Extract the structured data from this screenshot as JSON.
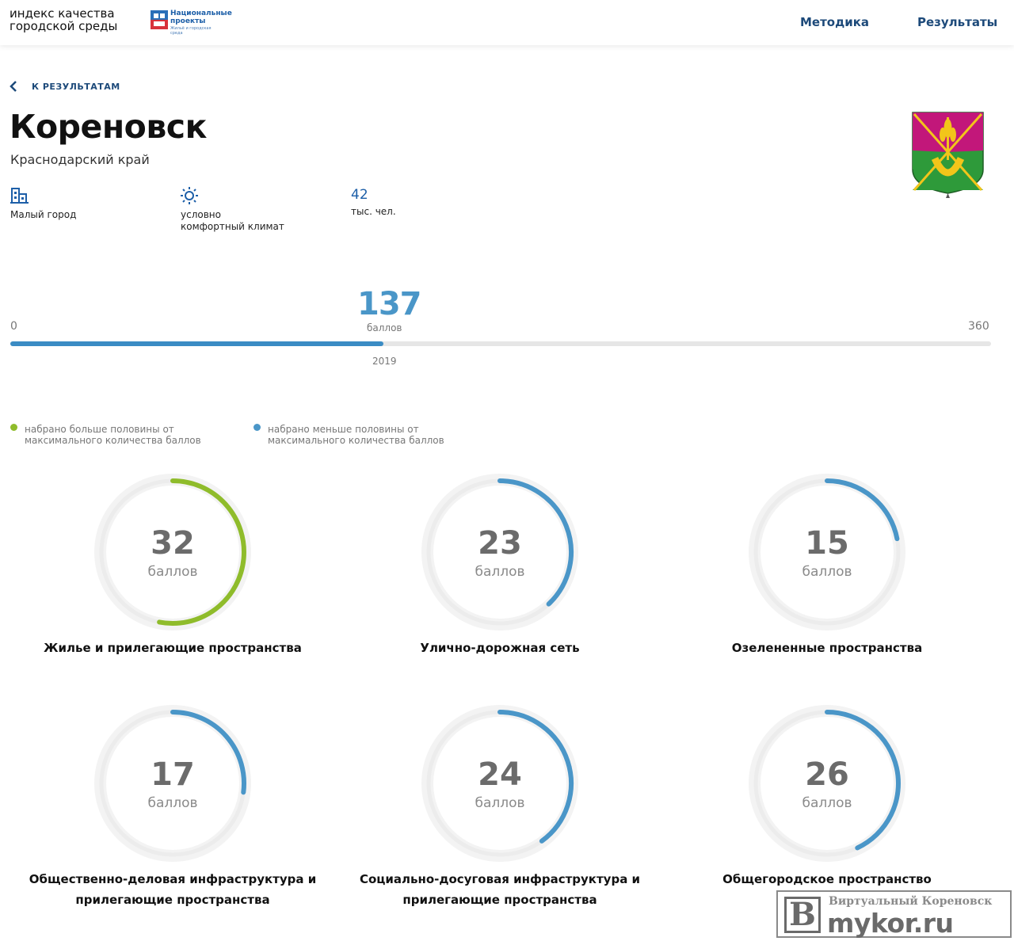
{
  "header": {
    "brand_line1": "индекс качества",
    "brand_line2": "городской среды",
    "np_title_line1": "Национальные",
    "np_title_line2": "проекты",
    "np_sub": "Жильё и городская среда",
    "nav": {
      "method": "Методика",
      "results": "Результаты"
    }
  },
  "back_label": "К РЕЗУЛЬТАТАМ",
  "city": {
    "name": "Кореновск",
    "region": "Краснодарский край"
  },
  "facts": {
    "size": "Малый город",
    "climate_line1": "условно",
    "climate_line2": "комфортный климат",
    "population": "42",
    "population_unit": "тыс. чел."
  },
  "score": {
    "min": "0",
    "max": "360",
    "total": "137",
    "unit": "баллов",
    "year": "2019",
    "fraction": 0.3806
  },
  "legend": {
    "above_half": "набрано больше половины от максимального количества баллов",
    "below_half": "набрано меньше половины от максимального количества баллов"
  },
  "colors": {
    "above_half": "#8fbc2b",
    "below_half": "#4a96c8",
    "track": "#ececec"
  },
  "categories": [
    {
      "score": "32",
      "unit": "баллов",
      "label_line1": "Жилье и прилегающие пространства",
      "label_line2": "",
      "fraction": 0.53,
      "status": "above_half"
    },
    {
      "score": "23",
      "unit": "баллов",
      "label_line1": "Улично-дорожная сеть",
      "label_line2": "",
      "fraction": 0.38,
      "status": "below_half"
    },
    {
      "score": "15",
      "unit": "баллов",
      "label_line1": "Озелененные пространства",
      "label_line2": "",
      "fraction": 0.22,
      "status": "below_half"
    },
    {
      "score": "17",
      "unit": "баллов",
      "label_line1": "Общественно-деловая инфраструктура и",
      "label_line2": "прилегающие пространства",
      "fraction": 0.27,
      "status": "below_half"
    },
    {
      "score": "24",
      "unit": "баллов",
      "label_line1": "Социально-досуговая инфраструктура и",
      "label_line2": "прилегающие пространства",
      "fraction": 0.4,
      "status": "below_half"
    },
    {
      "score": "26",
      "unit": "баллов",
      "label_line1": "Общегородское пространство",
      "label_line2": "",
      "fraction": 0.43,
      "status": "below_half"
    }
  ],
  "watermark": {
    "letter": "В",
    "top": "Виртуальный Кореновск",
    "main": "mykor.ru"
  }
}
